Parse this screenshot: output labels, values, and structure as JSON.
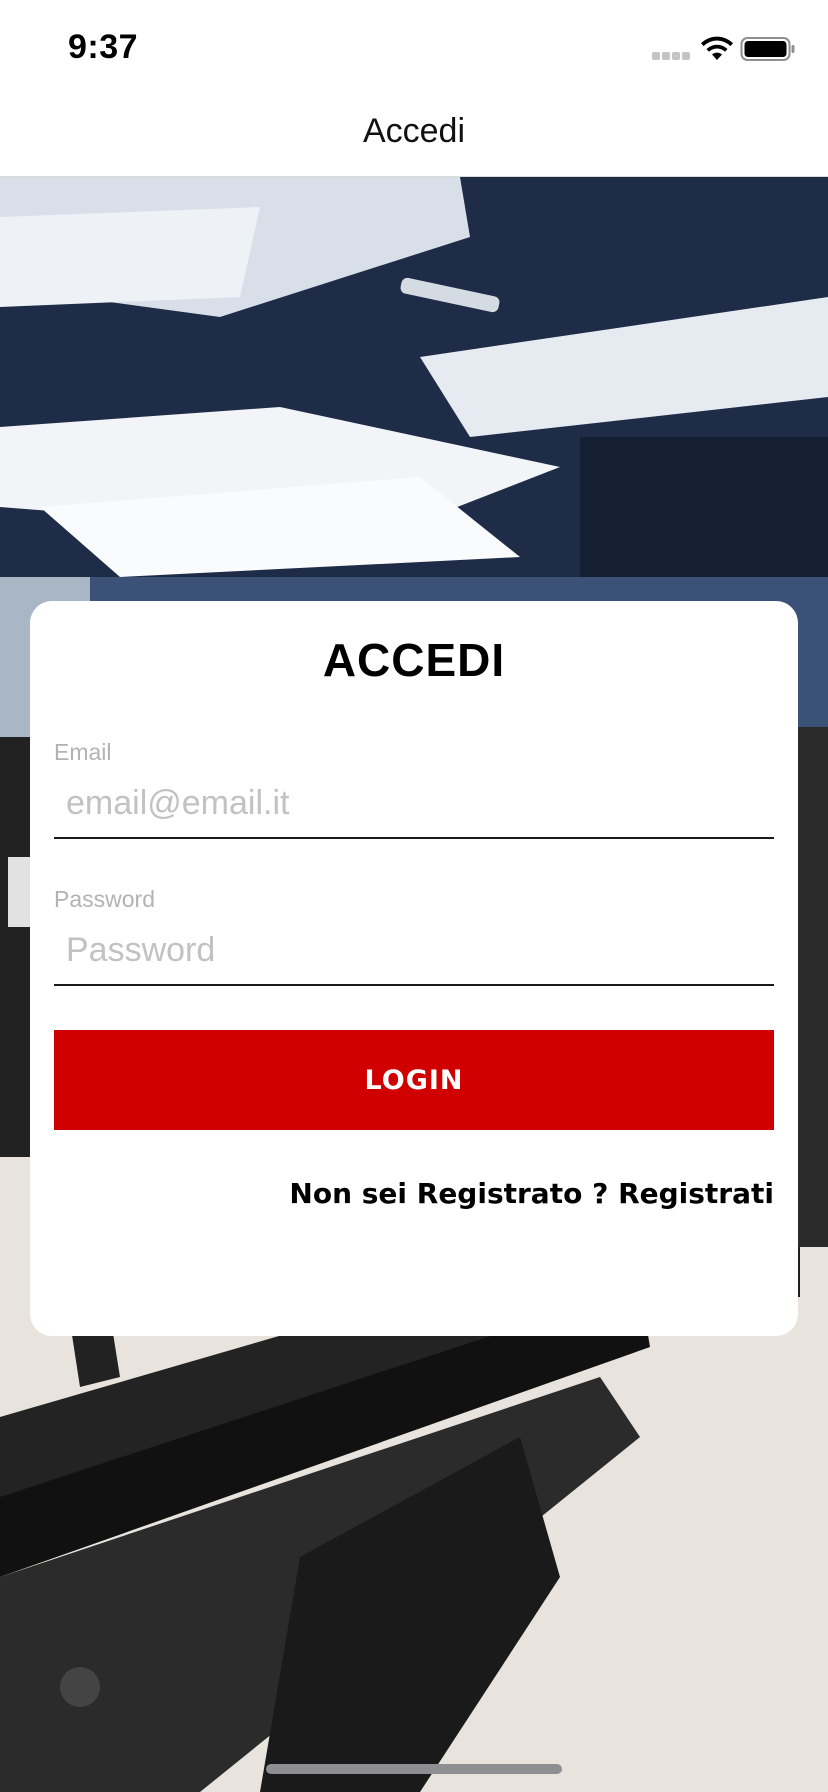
{
  "status_bar": {
    "time": "9:37",
    "icons": [
      "cellular-signal-icon",
      "wifi-icon",
      "battery-icon"
    ]
  },
  "nav": {
    "title": "Accedi"
  },
  "background": {
    "description_icon": "gym-photo"
  },
  "login_card": {
    "title": "ACCEDI",
    "email": {
      "label": "Email",
      "placeholder": "email@email.it",
      "value": ""
    },
    "password": {
      "label": "Password",
      "placeholder": "Password",
      "value": ""
    },
    "login_button_label": "LOGIN",
    "register_link": "Non sei Registrato ? Registrati"
  },
  "colors": {
    "accent": "#d00000",
    "card": "#ffffff",
    "label": "#b3b3b3"
  }
}
